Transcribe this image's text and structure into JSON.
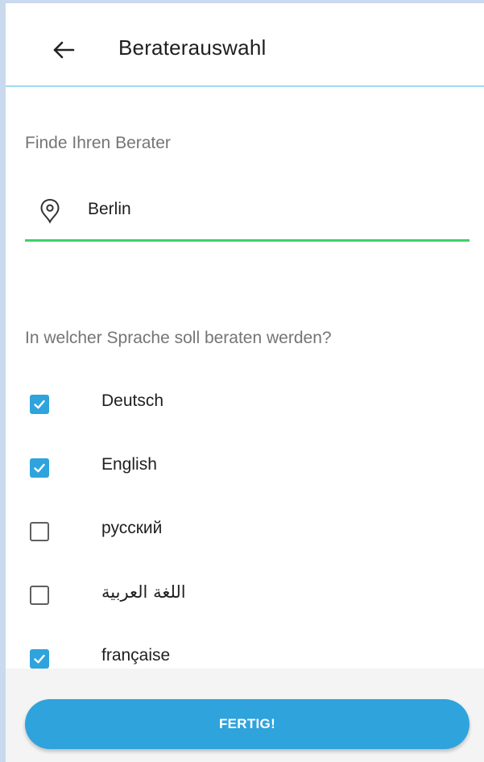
{
  "header": {
    "title": "Beraterauswahl",
    "back_icon": "arrow-left-icon"
  },
  "location": {
    "label": "Finde Ihren Berater",
    "value": "Berlin",
    "icon": "location-pin-icon"
  },
  "languages": {
    "label": "In welcher Sprache soll beraten werden?",
    "items": [
      {
        "label": "Deutsch",
        "checked": true
      },
      {
        "label": "English",
        "checked": true
      },
      {
        "label": "русский",
        "checked": false
      },
      {
        "label": "اللغة العربية",
        "checked": false
      },
      {
        "label": "française",
        "checked": true
      }
    ]
  },
  "footer": {
    "done_label": "FERTIG!"
  },
  "colors": {
    "accent": "#2fa3dc",
    "input_underline": "#3fd06b",
    "header_divider": "#9fdcea"
  }
}
